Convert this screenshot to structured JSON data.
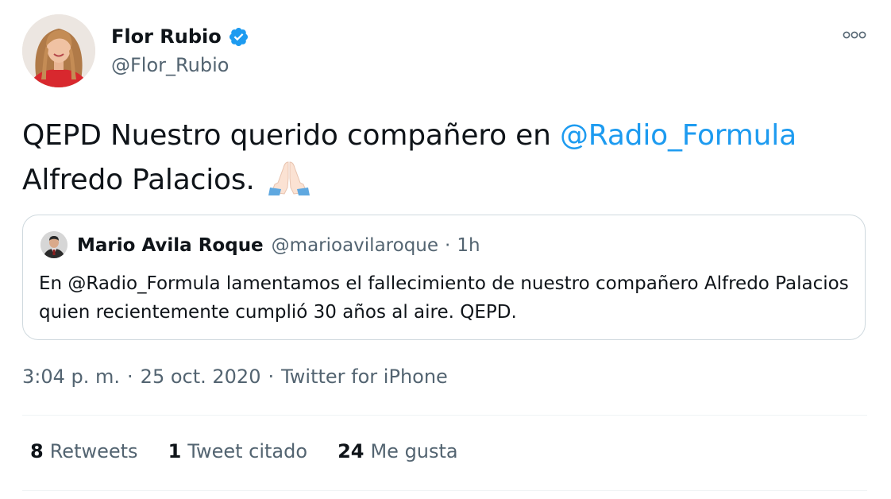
{
  "author": {
    "name": "Flor Rubio",
    "handle": "@Flor_Rubio",
    "verified": true
  },
  "tweet": {
    "text_before": "QEPD Nuestro querido compañero en",
    "mention": "@Radio_Formula",
    "text_after": "Alfredo Palacios.",
    "emoji": "folded-hands-emoji"
  },
  "quoted_tweet": {
    "name": "Mario Avila Roque",
    "handle": "@marioavilaroque",
    "separator": "·",
    "time": "1h",
    "text": "En @Radio_Formula lamentamos el fallecimiento de nuestro compañero Alfredo Palacios quien recientemente cumplió 30 años al aire. QEPD."
  },
  "meta": {
    "time": "3:04 p. m.",
    "date": "25 oct. 2020",
    "separator": "·",
    "source": "Twitter for iPhone"
  },
  "stats": [
    {
      "count": "8",
      "label": "Retweets"
    },
    {
      "count": "1",
      "label": "Tweet citado"
    },
    {
      "count": "24",
      "label": "Me gusta"
    }
  ],
  "colors": {
    "link": "#1d9bf0",
    "secondary_text": "#536471",
    "primary_text": "#0f1419",
    "border": "#cfd9de",
    "verified_badge": "#1d9bf0"
  },
  "icons": {
    "verified": "verified-badge-icon",
    "more": "more-options-icon"
  }
}
